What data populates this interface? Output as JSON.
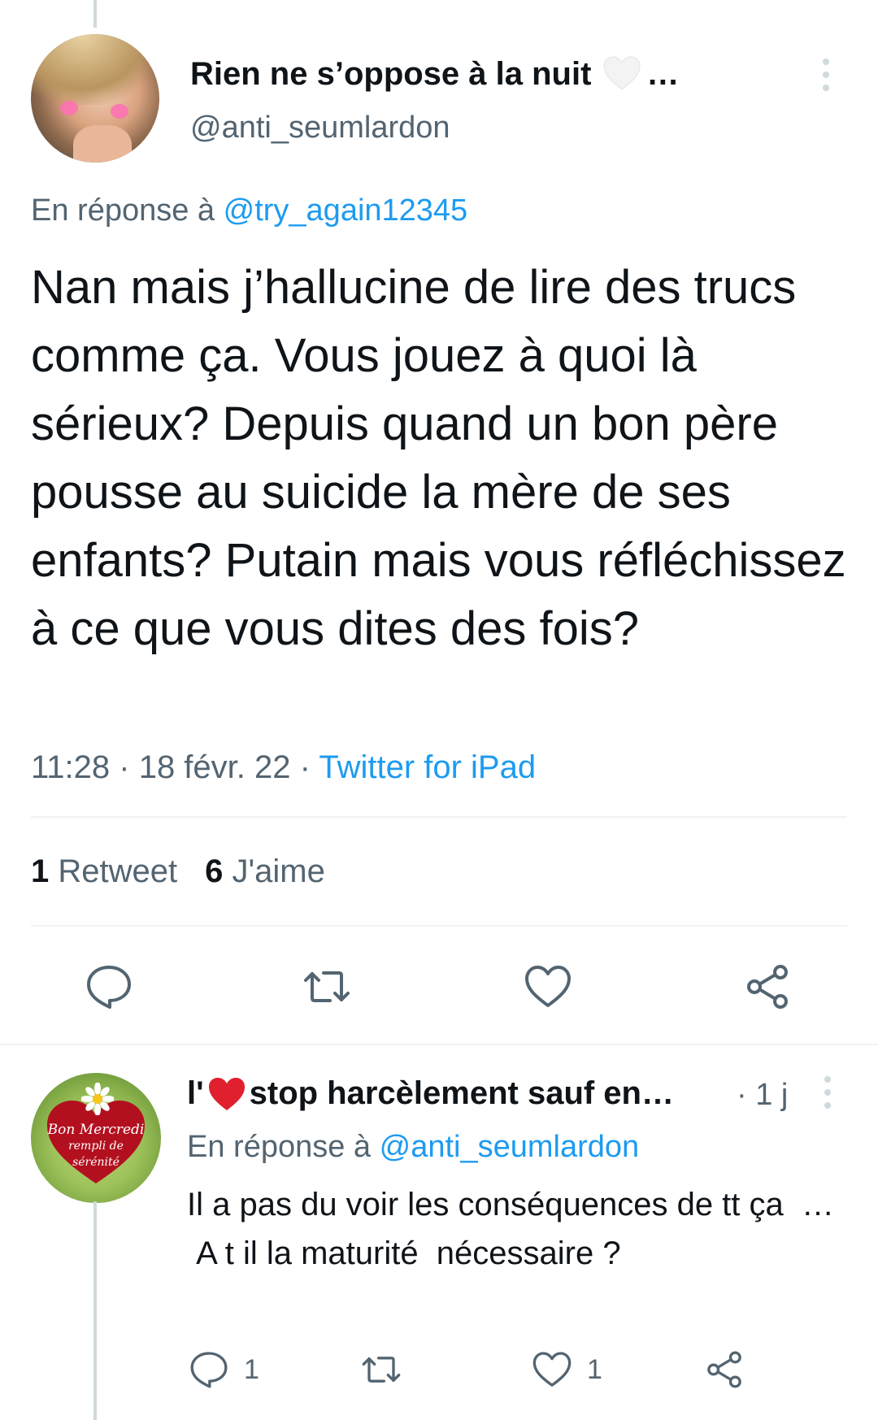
{
  "tweet": {
    "author_name": "Rien ne s’oppose à la nuit",
    "author_name_suffix": "…",
    "handle": "@anti_seumlardon",
    "reply_prefix": "En réponse à",
    "reply_to": "@try_again12345",
    "text": "Nan mais j’hallucine de lire des trucs comme ça. Vous jouez à quoi là sérieux? Depuis quand un bon père pousse au suicide la mère de ses enfants? Putain mais vous réfléchissez à ce que vous dites des fois?",
    "time": "11:28",
    "date": "18 févr. 22",
    "source": "Twitter for iPad",
    "retweet_count": "1",
    "retweet_label": "Retweet",
    "like_count": "6",
    "like_label": "J'aime"
  },
  "reply": {
    "author_prefix": "l'",
    "author_name": "stop harcèlement sauf en…",
    "time": "· 1 j",
    "reply_prefix": "En réponse à",
    "reply_to": "@anti_seumlardon",
    "text": "Il a pas du voir les conséquences de tt ça  …\n A t il la maturité  nécessaire ?",
    "reply_count": "1",
    "like_count": "1",
    "avatar_text_line1": "Bon Mercredi",
    "avatar_text_line2": "rempli de",
    "avatar_text_line3": "sérénité"
  },
  "colors": {
    "text": "#0f1419",
    "secondary": "#536471",
    "link": "#1d9bf0",
    "divider": "#eff3f4",
    "thread_line": "#cfd9de",
    "heart_red": "#e0202e"
  },
  "icons": [
    "more-vertical-icon",
    "reply-icon",
    "retweet-icon",
    "like-icon",
    "share-icon",
    "white-heart-emoji",
    "red-heart-emoji"
  ]
}
